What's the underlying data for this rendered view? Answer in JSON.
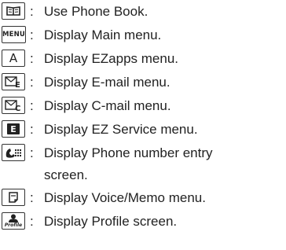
{
  "items": [
    {
      "key_icon": "phone-book-key-icon",
      "text": "Use Phone Book."
    },
    {
      "key_icon": "menu-key-icon",
      "key_label": "MENU",
      "text": "Display Main menu."
    },
    {
      "key_icon": "ezapps-key-icon",
      "key_label": "A",
      "text": "Display EZapps menu."
    },
    {
      "key_icon": "email-key-icon",
      "text": "Display E-mail menu."
    },
    {
      "key_icon": "cmail-key-icon",
      "text": "Display C-mail menu."
    },
    {
      "key_icon": "ez-service-key-icon",
      "key_label": "E",
      "text": "Display EZ Service menu."
    },
    {
      "key_icon": "call-key-icon",
      "text": "Display Phone number entry",
      "text_continued": "screen."
    },
    {
      "key_icon": "voice-memo-key-icon",
      "text": "Display Voice/Memo menu."
    },
    {
      "key_icon": "profile-key-icon",
      "key_label": "Profile",
      "text": "Display Profile screen."
    }
  ],
  "separator": ":"
}
